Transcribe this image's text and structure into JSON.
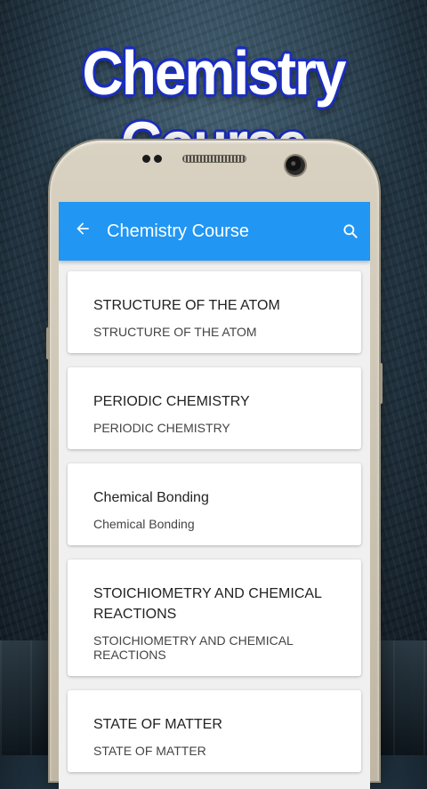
{
  "promo": {
    "title": "Chemistry Course"
  },
  "appbar": {
    "title": "Chemistry Course",
    "back_icon": "arrow-back-icon",
    "search_icon": "search-icon"
  },
  "colors": {
    "accent": "#2196f3",
    "promo_outline": "#1a2dbf"
  },
  "items": [
    {
      "title": "STRUCTURE OF THE ATOM",
      "subtitle": "STRUCTURE OF THE ATOM"
    },
    {
      "title": "PERIODIC CHEMISTRY",
      "subtitle": "PERIODIC CHEMISTRY"
    },
    {
      "title": "Chemical Bonding",
      "subtitle": "Chemical Bonding"
    },
    {
      "title": "STOICHIOMETRY AND CHEMICAL REACTIONS",
      "subtitle": "STOICHIOMETRY AND CHEMICAL REACTIONS"
    },
    {
      "title": "STATE OF MATTER",
      "subtitle": "STATE OF MATTER"
    }
  ]
}
